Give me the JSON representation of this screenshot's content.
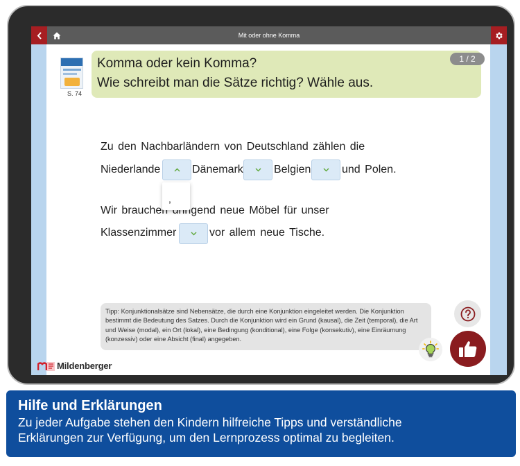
{
  "topbar": {
    "title": "Mit oder ohne Komma",
    "icons": {
      "back": "chevron-left-icon",
      "home": "home-icon",
      "settings": "gear-icon"
    }
  },
  "book": {
    "page_ref": "S. 74"
  },
  "question": {
    "line1": "Komma oder kein Komma?",
    "line2": "Wie schreibt man die Sätze richtig? Wähle aus.",
    "counter": "1 / 2"
  },
  "exercise": {
    "sentence1_line1": "Zu den Nachbarländern von Deutschland zählen die",
    "s1_seg1": "Niederlande",
    "s1_seg2": "Dänemark",
    "s1_seg3": "Belgien",
    "s1_seg4": "und Polen.",
    "dropdown_open_option": ",",
    "s2_seg1": "Wir brauchen dringend neue Möbel für unser",
    "s2_seg2": "Klassenzimmer",
    "s2_seg3": "vor allem neue Tische."
  },
  "tip": {
    "text": "Tipp: Konjunktionalsätze sind Nebensätze, die durch eine Konjunktion eingeleitet werden. Die Konjunktion bestimmt die Bedeutung des Satzes. Durch die Konjunktion wird ein Grund (kausal), die Zeit (temporal), die Art und Weise (modal), ein Ort (lokal), eine Bedingung (konditional), eine Folge (konsekutiv), eine Einräumung (konzessiv) oder eine Absicht (final) angegeben."
  },
  "brand": {
    "name": "Mildenberger"
  },
  "caption": {
    "title": "Hilfe und Erklärungen",
    "text_line1": "Zu jeder Aufgabe stehen den Kindern hilfreiche Tipps und verständliche",
    "text_line2": "Erklärungen zur Verfügung, um den Lernprozess optimal zu begleiten."
  },
  "colors": {
    "accent_red": "#a61e22",
    "like_button": "#8a1c1f",
    "question_bg": "#dfe9b8",
    "dropdown_bg": "#dbeaf7",
    "caption_bg": "#0f4e9d",
    "dropdown_chevron": "#5fa83a"
  }
}
